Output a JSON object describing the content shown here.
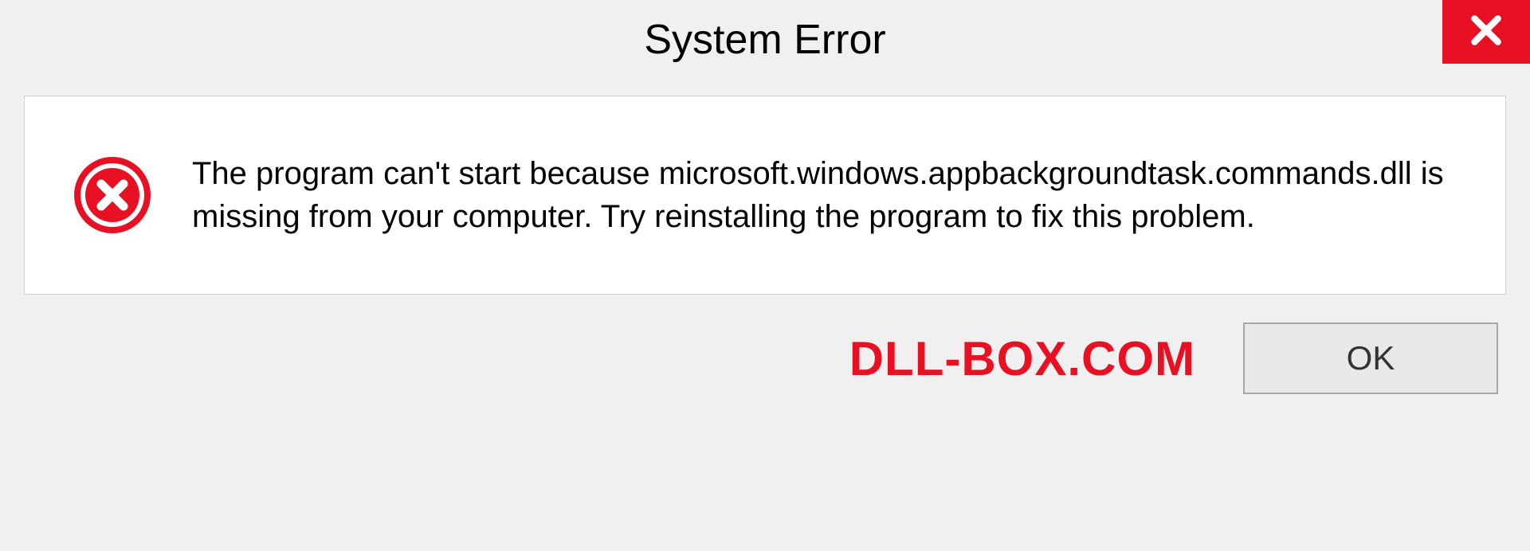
{
  "dialog": {
    "title": "System Error",
    "message": "The program can't start because microsoft.windows.appbackgroundtask.commands.dll is missing from your computer. Try reinstalling the program to fix this problem.",
    "ok_label": "OK"
  },
  "watermark": "DLL-BOX.COM",
  "colors": {
    "close_bg": "#e81123",
    "error_icon": "#e81123",
    "watermark": "#e81123"
  }
}
